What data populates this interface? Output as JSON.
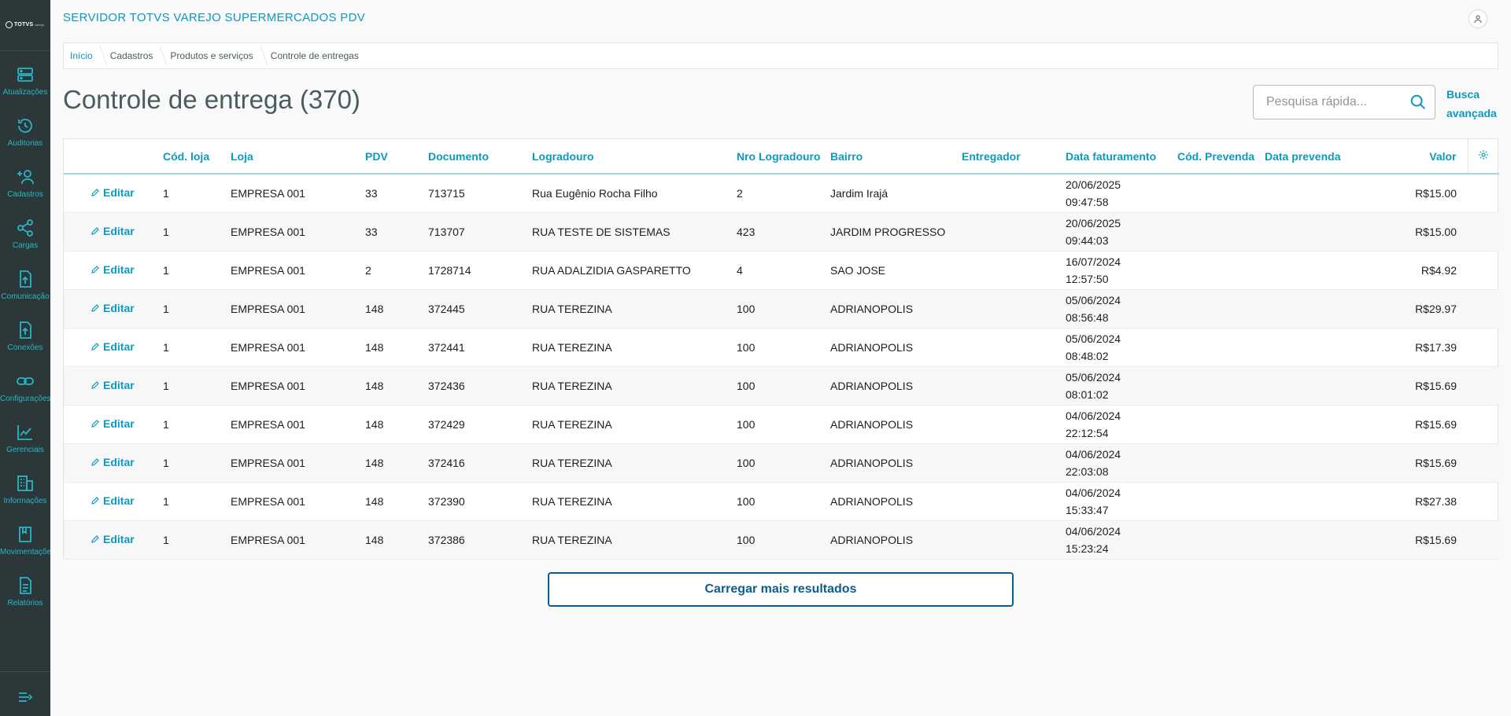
{
  "app": {
    "title": "SERVIDOR TOTVS VAREJO SUPERMERCADOS PDV",
    "logo_text": "TOTVS",
    "logo_sub": "varejo"
  },
  "sidebar": {
    "items": [
      {
        "label": "Atualizações",
        "icon": "server-icon"
      },
      {
        "label": "Auditorias",
        "icon": "history-icon"
      },
      {
        "label": "Cadastros",
        "icon": "user-add-icon"
      },
      {
        "label": "Cargas",
        "icon": "share-icon"
      },
      {
        "label": "Comunicação",
        "icon": "upload-file-icon"
      },
      {
        "label": "Conexões",
        "icon": "upload-file-icon"
      },
      {
        "label": "Configurações",
        "icon": "link-icon"
      },
      {
        "label": "Gerenciais",
        "icon": "chart-icon"
      },
      {
        "label": "Informações",
        "icon": "building-icon"
      },
      {
        "label": "Movimentações",
        "icon": "book-icon"
      },
      {
        "label": "Relatórios",
        "icon": "document-icon"
      }
    ]
  },
  "breadcrumb": [
    "Início",
    "Cadastros",
    "Produtos e serviços",
    "Controle de entregas"
  ],
  "page": {
    "title": "Controle de entrega (370)"
  },
  "search": {
    "placeholder": "Pesquisa rápida...",
    "value": "",
    "advanced_label_1": "Busca",
    "advanced_label_2": "avançada"
  },
  "table": {
    "edit_label": "Editar",
    "columns": [
      "",
      "Cód. loja",
      "Loja",
      "PDV",
      "Documento",
      "Logradouro",
      "Nro Logradouro",
      "Bairro",
      "Entregador",
      "Data faturamento",
      "Cód. Prevenda",
      "Data prevenda",
      "Valor"
    ],
    "rows": [
      {
        "cod_loja": "1",
        "loja": "EMPRESA 001",
        "pdv": "33",
        "documento": "713715",
        "logradouro": "Rua Eugênio Rocha Filho",
        "nro": "2",
        "bairro": "Jardim Irajá",
        "entregador": "",
        "data": "20/06/2025",
        "hora": "09:47:58",
        "cod_prevenda": "",
        "data_prevenda": "",
        "valor": "R$15.00"
      },
      {
        "cod_loja": "1",
        "loja": "EMPRESA 001",
        "pdv": "33",
        "documento": "713707",
        "logradouro": "RUA TESTE DE SISTEMAS",
        "nro": "423",
        "bairro": "JARDIM PROGRESSO",
        "entregador": "",
        "data": "20/06/2025",
        "hora": "09:44:03",
        "cod_prevenda": "",
        "data_prevenda": "",
        "valor": "R$15.00"
      },
      {
        "cod_loja": "1",
        "loja": "EMPRESA 001",
        "pdv": "2",
        "documento": "1728714",
        "logradouro": "RUA ADALZIDIA GASPARETTO",
        "nro": "4",
        "bairro": "SAO JOSE",
        "entregador": "",
        "data": "16/07/2024",
        "hora": "12:57:50",
        "cod_prevenda": "",
        "data_prevenda": "",
        "valor": "R$4.92"
      },
      {
        "cod_loja": "1",
        "loja": "EMPRESA 001",
        "pdv": "148",
        "documento": "372445",
        "logradouro": "RUA TEREZINA",
        "nro": "100",
        "bairro": "ADRIANOPOLIS",
        "entregador": "",
        "data": "05/06/2024",
        "hora": "08:56:48",
        "cod_prevenda": "",
        "data_prevenda": "",
        "valor": "R$29.97"
      },
      {
        "cod_loja": "1",
        "loja": "EMPRESA 001",
        "pdv": "148",
        "documento": "372441",
        "logradouro": "RUA TEREZINA",
        "nro": "100",
        "bairro": "ADRIANOPOLIS",
        "entregador": "",
        "data": "05/06/2024",
        "hora": "08:48:02",
        "cod_prevenda": "",
        "data_prevenda": "",
        "valor": "R$17.39"
      },
      {
        "cod_loja": "1",
        "loja": "EMPRESA 001",
        "pdv": "148",
        "documento": "372436",
        "logradouro": "RUA TEREZINA",
        "nro": "100",
        "bairro": "ADRIANOPOLIS",
        "entregador": "",
        "data": "05/06/2024",
        "hora": "08:01:02",
        "cod_prevenda": "",
        "data_prevenda": "",
        "valor": "R$15.69"
      },
      {
        "cod_loja": "1",
        "loja": "EMPRESA 001",
        "pdv": "148",
        "documento": "372429",
        "logradouro": "RUA TEREZINA",
        "nro": "100",
        "bairro": "ADRIANOPOLIS",
        "entregador": "",
        "data": "04/06/2024",
        "hora": "22:12:54",
        "cod_prevenda": "",
        "data_prevenda": "",
        "valor": "R$15.69"
      },
      {
        "cod_loja": "1",
        "loja": "EMPRESA 001",
        "pdv": "148",
        "documento": "372416",
        "logradouro": "RUA TEREZINA",
        "nro": "100",
        "bairro": "ADRIANOPOLIS",
        "entregador": "",
        "data": "04/06/2024",
        "hora": "22:03:08",
        "cod_prevenda": "",
        "data_prevenda": "",
        "valor": "R$15.69"
      },
      {
        "cod_loja": "1",
        "loja": "EMPRESA 001",
        "pdv": "148",
        "documento": "372390",
        "logradouro": "RUA TEREZINA",
        "nro": "100",
        "bairro": "ADRIANOPOLIS",
        "entregador": "",
        "data": "04/06/2024",
        "hora": "15:33:47",
        "cod_prevenda": "",
        "data_prevenda": "",
        "valor": "R$27.38"
      },
      {
        "cod_loja": "1",
        "loja": "EMPRESA 001",
        "pdv": "148",
        "documento": "372386",
        "logradouro": "RUA TEREZINA",
        "nro": "100",
        "bairro": "ADRIANOPOLIS",
        "entregador": "",
        "data": "04/06/2024",
        "hora": "15:23:24",
        "cod_prevenda": "",
        "data_prevenda": "",
        "valor": "R$15.69"
      }
    ]
  },
  "load_more_label": "Carregar mais resultados",
  "colors": {
    "sidebar_bg": "#2c3739",
    "accent": "#0c9abe",
    "sidebar_accent": "#29b6c5",
    "primary_dark": "#0b5d8f"
  }
}
